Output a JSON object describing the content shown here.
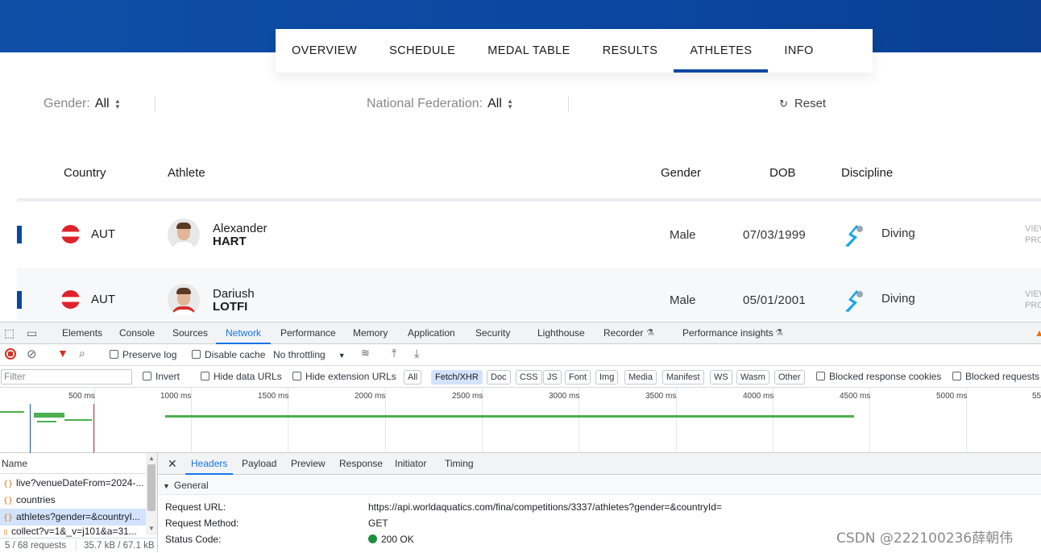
{
  "nav": {
    "tabs": [
      {
        "label": "OVERVIEW"
      },
      {
        "label": "SCHEDULE"
      },
      {
        "label": "MEDAL TABLE"
      },
      {
        "label": "RESULTS"
      },
      {
        "label": "ATHLETES",
        "active": true
      },
      {
        "label": "INFO"
      }
    ]
  },
  "filters": {
    "gender_label": "Gender:",
    "gender_value": "All",
    "federation_label": "National Federation:",
    "federation_value": "All",
    "reset_label": "Reset"
  },
  "table": {
    "headers": {
      "country": "Country",
      "athlete": "Athlete",
      "gender": "Gender",
      "dob": "DOB",
      "discipline": "Discipline"
    },
    "rows": [
      {
        "country": "AUT",
        "first_name": "Alexander",
        "last_name": "HART",
        "gender": "Male",
        "dob": "07/03/1999",
        "discipline": "Diving",
        "view": "VIEW PROFILE"
      },
      {
        "country": "AUT",
        "first_name": "Dariush",
        "last_name": "LOTFI",
        "gender": "Male",
        "dob": "05/01/2001",
        "discipline": "Diving",
        "view": "VIEW PROFILE"
      }
    ]
  },
  "devtools": {
    "tabs": [
      "Elements",
      "Console",
      "Sources",
      "Network",
      "Performance",
      "Memory",
      "Application",
      "Security",
      "Lighthouse",
      "Recorder",
      "Performance insights"
    ],
    "active_tab": "Network",
    "toolbar": {
      "preserve_log": "Preserve log",
      "disable_cache": "Disable cache",
      "throttling": "No throttling"
    },
    "filter_bar": {
      "placeholder": "Filter",
      "invert": "Invert",
      "hide_data_urls": "Hide data URLs",
      "hide_extension_urls": "Hide extension URLs",
      "types": [
        "All",
        "Fetch/XHR",
        "Doc",
        "CSS",
        "JS",
        "Font",
        "Img",
        "Media",
        "Manifest",
        "WS",
        "Wasm",
        "Other"
      ],
      "active_type": "Fetch/XHR",
      "blocked_cookies": "Blocked response cookies",
      "blocked_requests": "Blocked requests"
    },
    "timeline": {
      "ticks": [
        "500 ms",
        "1000 ms",
        "1500 ms",
        "2000 ms",
        "2500 ms",
        "3000 ms",
        "3500 ms",
        "4000 ms",
        "4500 ms",
        "5000 ms",
        "55"
      ]
    },
    "requests": {
      "header": "Name",
      "items": [
        {
          "name": "live?venueDateFrom=2024-..."
        },
        {
          "name": "countries"
        },
        {
          "name": "athletes?gender=&countryI...",
          "selected": true
        },
        {
          "name": "collect?v=1&_v=j101&a=31..."
        }
      ],
      "summary_requests": "5 / 68 requests",
      "summary_size": "35.7 kB / 67.1 kB"
    },
    "details": {
      "tabs": [
        "Headers",
        "Payload",
        "Preview",
        "Response",
        "Initiator",
        "Timing"
      ],
      "active_tab": "Headers",
      "section": "General",
      "request_url_label": "Request URL:",
      "request_url": "https://api.worldaquatics.com/fina/competitions/3337/athletes?gender=&countryId=",
      "method_label": "Request Method:",
      "method": "GET",
      "status_label": "Status Code:",
      "status": "200 OK"
    }
  },
  "watermark": "CSDN @222100236薛朝伟"
}
